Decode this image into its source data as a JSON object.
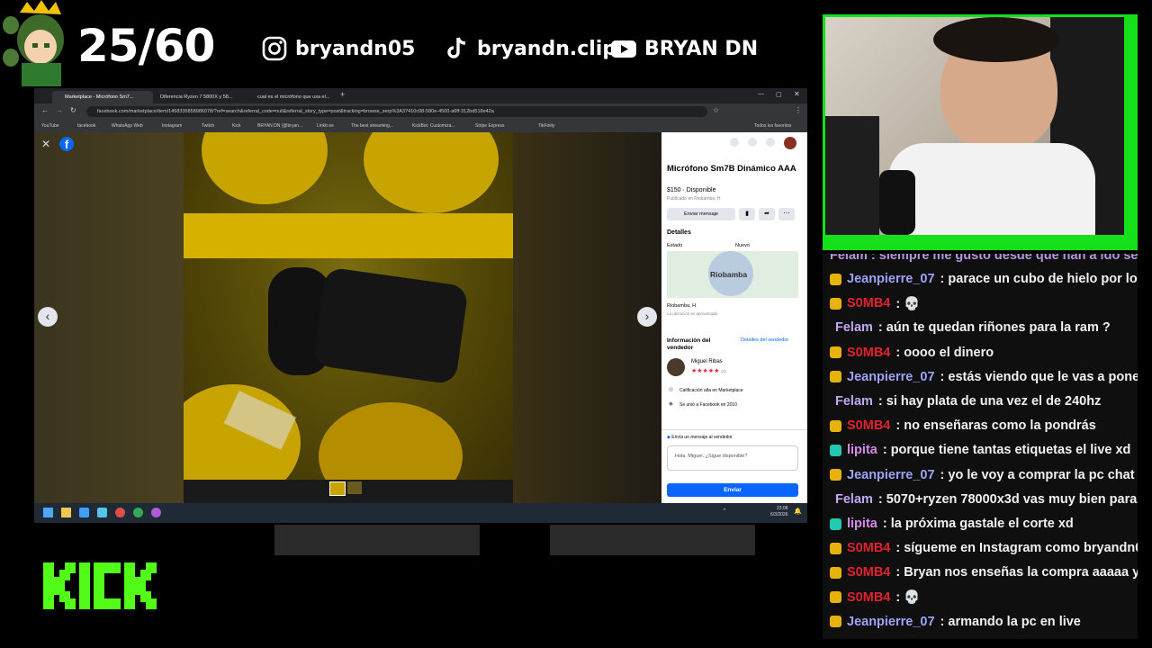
{
  "overlay": {
    "counter": "25/60",
    "socials": [
      {
        "icon": "instagram-icon",
        "handle": "bryandn05"
      },
      {
        "icon": "tiktok-icon",
        "handle": "bryandn.clip"
      },
      {
        "icon": "youtube-icon",
        "handle": "BRYAN DN"
      }
    ],
    "kick_logo": "KICK",
    "colors": {
      "kick_green": "#53fc18",
      "cam_border": "#15e01a"
    }
  },
  "browser": {
    "tabs": [
      {
        "label": "Marketplace - Micrófono Sm7...",
        "active": true
      },
      {
        "label": "Diferencia Ryzen 7 5800X y 58...",
        "active": false
      },
      {
        "label": "cual es el micrófono que usa el...",
        "active": false
      }
    ],
    "url": "facebook.com/marketplace/item/1458335858986078/?ref=search&referral_code=null&referral_story_type=post&tracking=browse_serp%3A37410c08-580e-4500-a6ff-312bd518e42a",
    "bookmarks": [
      "YouTube",
      "facebook",
      "WhatsApp Web",
      "Instagram",
      "Twitch",
      "Kick",
      "BRYAN DN (@bryan...",
      "Linktr.ee",
      "The best streaming...",
      "KickBot: Customiza...",
      "Stripe Express",
      "TikFinity",
      "Todos los favoritos"
    ]
  },
  "listing": {
    "title": "Micrófono Sm7B Dinámico AAA",
    "price_status": "$150 · Disponible",
    "published": "Publicado en Riobamba, H",
    "send_message_label": "Enviar mensaje",
    "details_heading": "Detalles",
    "condition_label": "Estado",
    "condition_value": "Nuevo",
    "map_city": "Riobamba",
    "location": "Riobamba, H",
    "location_note": "La ubicación es aproximada",
    "seller_heading": "Información del vendedor",
    "seller_details_link": "Detalles del vendedor",
    "seller_name": "Miguel Ribas",
    "seller_rating_count": "(4)",
    "seller_rating": 5,
    "badge_text": "Calificación alta en Marketplace",
    "joined": "Se unió a Facebook en 2010",
    "message_prompt": "Envía un mensaje al vendedor",
    "message_text": "Hola, Miguel. ¿Sigue disponible?",
    "send_button": "Enviar"
  },
  "taskbar": {
    "time": "23:08",
    "date": "6/3/2026"
  },
  "chat": {
    "partial_top": "Felam : siempre me gusto desde que han a ido se",
    "messages": [
      {
        "user": "Jeanpierre_07",
        "color": "#9ea2f5",
        "badge": "#e8b20c",
        "text": ": parace un cubo de hielo por lo"
      },
      {
        "user": "S0MB4",
        "color": "#e0222f",
        "badge": "#e8b20c",
        "text": ": 💀"
      },
      {
        "user": "Felam",
        "color": "#c2a8f0",
        "badge": "",
        "text": ": aún te quedan riñones para la ram ?"
      },
      {
        "user": "S0MB4",
        "color": "#e0222f",
        "badge": "#e8b20c",
        "text": ": oooo el dinero"
      },
      {
        "user": "Jeanpierre_07",
        "color": "#9ea2f5",
        "badge": "#e8b20c",
        "text": ": estás viendo que le vas a pone"
      },
      {
        "user": "Felam",
        "color": "#c2a8f0",
        "badge": "",
        "text": ": si hay plata de una vez el de 240hz"
      },
      {
        "user": "S0MB4",
        "color": "#e0222f",
        "badge": "#e8b20c",
        "text": ": no enseñaras como la pondrás"
      },
      {
        "user": "lipita",
        "color": "#d68ae8",
        "badge": "#20c9b0",
        "text": ": porque tiene tantas etiquetas el live xd"
      },
      {
        "user": "Jeanpierre_07",
        "color": "#9ea2f5",
        "badge": "#e8b20c",
        "text": ": yo le voy a comprar la pc chat"
      },
      {
        "user": "Felam",
        "color": "#c2a8f0",
        "badge": "",
        "text": ": 5070+ryzen 78000x3d vas muy bien para"
      },
      {
        "user": "lipita",
        "color": "#d68ae8",
        "badge": "#20c9b0",
        "text": ": la próxima gastale el corte xd"
      },
      {
        "user": "S0MB4",
        "color": "#e0222f",
        "badge": "#e8b20c",
        "text": ": sígueme en Instagram como bryandn0"
      },
      {
        "user": "S0MB4",
        "color": "#e0222f",
        "badge": "#e8b20c",
        "text": ": Bryan nos enseñas la compra aaaaa y"
      },
      {
        "user": "S0MB4",
        "color": "#e0222f",
        "badge": "#e8b20c",
        "text": ": 💀"
      },
      {
        "user": "Jeanpierre_07",
        "color": "#9ea2f5",
        "badge": "#e8b20c",
        "text": ": armando la pc en live"
      }
    ]
  }
}
